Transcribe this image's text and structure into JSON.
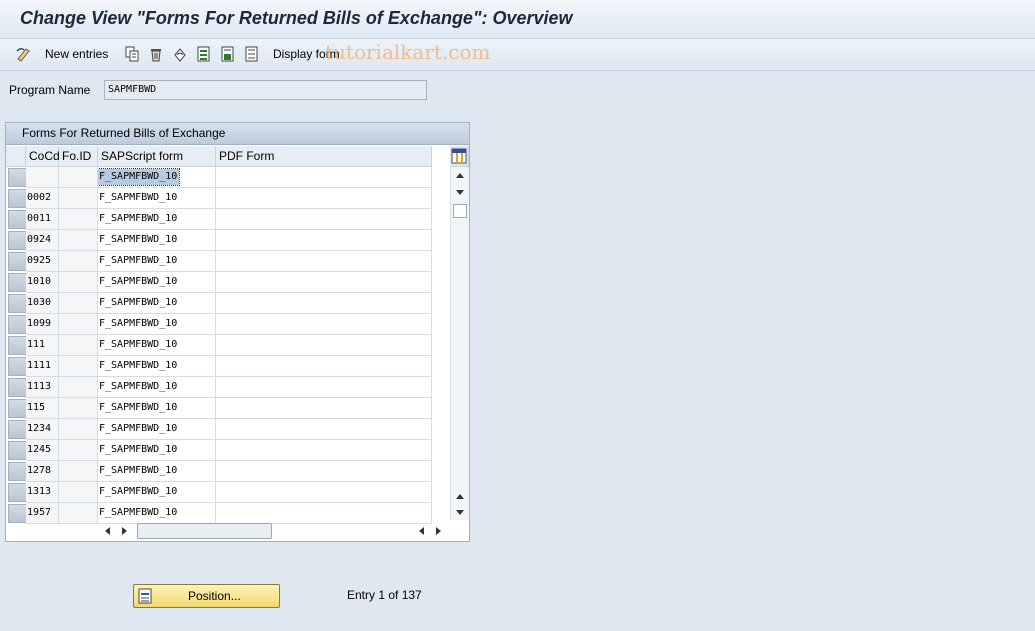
{
  "title": "Change View \"Forms For Returned Bills of Exchange\": Overview",
  "toolbar": {
    "new_entries": "New entries",
    "display_form": "Display form",
    "icons": [
      "edit-pencil-icon",
      "copy-icon",
      "delete-icon",
      "undo-icon",
      "select-all-icon",
      "select-block-icon",
      "deselect-all-icon"
    ]
  },
  "watermark": "tutorialkart.com",
  "program": {
    "label": "Program Name",
    "value": "SAPMFBWD"
  },
  "table": {
    "title": "Forms For Returned Bills of Exchange",
    "columns": [
      "CoCd",
      "Fo.ID",
      "SAPScript form",
      "PDF Form"
    ],
    "rows": [
      {
        "cocd": "",
        "foid": "",
        "sapscript": "F_SAPMFBWD_10",
        "pdf": ""
      },
      {
        "cocd": "0002",
        "foid": "",
        "sapscript": "F_SAPMFBWD_10",
        "pdf": ""
      },
      {
        "cocd": "0011",
        "foid": "",
        "sapscript": "F_SAPMFBWD_10",
        "pdf": ""
      },
      {
        "cocd": "0924",
        "foid": "",
        "sapscript": "F_SAPMFBWD_10",
        "pdf": ""
      },
      {
        "cocd": "0925",
        "foid": "",
        "sapscript": "F_SAPMFBWD_10",
        "pdf": ""
      },
      {
        "cocd": "1010",
        "foid": "",
        "sapscript": "F_SAPMFBWD_10",
        "pdf": ""
      },
      {
        "cocd": "1030",
        "foid": "",
        "sapscript": "F_SAPMFBWD_10",
        "pdf": ""
      },
      {
        "cocd": "1099",
        "foid": "",
        "sapscript": "F_SAPMFBWD_10",
        "pdf": ""
      },
      {
        "cocd": "111",
        "foid": "",
        "sapscript": "F_SAPMFBWD_10",
        "pdf": ""
      },
      {
        "cocd": "1111",
        "foid": "",
        "sapscript": "F_SAPMFBWD_10",
        "pdf": ""
      },
      {
        "cocd": "1113",
        "foid": "",
        "sapscript": "F_SAPMFBWD_10",
        "pdf": ""
      },
      {
        "cocd": "115",
        "foid": "",
        "sapscript": "F_SAPMFBWD_10",
        "pdf": ""
      },
      {
        "cocd": "1234",
        "foid": "",
        "sapscript": "F_SAPMFBWD_10",
        "pdf": ""
      },
      {
        "cocd": "1245",
        "foid": "",
        "sapscript": "F_SAPMFBWD_10",
        "pdf": ""
      },
      {
        "cocd": "1278",
        "foid": "",
        "sapscript": "F_SAPMFBWD_10",
        "pdf": ""
      },
      {
        "cocd": "1313",
        "foid": "",
        "sapscript": "F_SAPMFBWD_10",
        "pdf": ""
      },
      {
        "cocd": "1957",
        "foid": "",
        "sapscript": "F_SAPMFBWD_10",
        "pdf": ""
      }
    ]
  },
  "position_button": "Position...",
  "entry_info": "Entry 1 of 137"
}
